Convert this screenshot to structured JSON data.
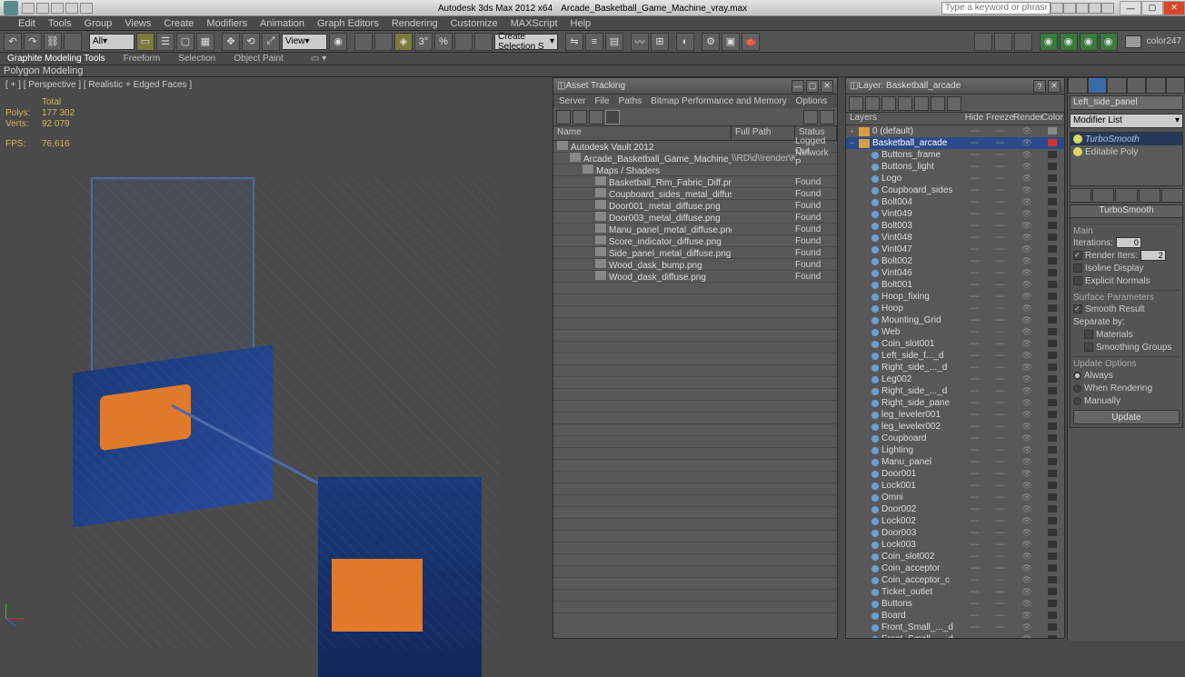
{
  "titlebar": {
    "app": "Autodesk 3ds Max 2012 x64",
    "file": "Arcade_Basketball_Game_Machine_vray.max",
    "search_placeholder": "Type a keyword or phrase"
  },
  "menu": [
    "Edit",
    "Tools",
    "Group",
    "Views",
    "Create",
    "Modifiers",
    "Animation",
    "Graph Editors",
    "Rendering",
    "Customize",
    "MAXScript",
    "Help"
  ],
  "toolbar": {
    "sel_filter": "All",
    "named_sel": "Create Selection S",
    "ref_coord": "View",
    "swatch_label": "color247"
  },
  "ribbon": [
    "Graphite Modeling Tools",
    "Freeform",
    "Selection",
    "Object Paint"
  ],
  "poly_label": "Polygon Modeling",
  "viewport": {
    "label": "[ + ] [ Perspective ] [ Realistic + Edged Faces ]",
    "stats": {
      "total": "Total",
      "polys_l": "Polys:",
      "polys": "177 302",
      "verts_l": "Verts:",
      "verts": "92 079",
      "fps_l": "FPS:",
      "fps": "76,616"
    }
  },
  "asset": {
    "title": "Asset Tracking",
    "menu": [
      "Server",
      "File",
      "Paths",
      "Bitmap Performance and Memory",
      "Options"
    ],
    "cols": {
      "name": "Name",
      "path": "Full Path",
      "status": "Status"
    },
    "rows": [
      {
        "indent": 0,
        "icon": "vault",
        "name": "Autodesk Vault 2012",
        "path": "",
        "status": "Logged Out"
      },
      {
        "indent": 1,
        "icon": "max",
        "name": "Arcade_Basketball_Game_Machine_vray....",
        "path": "\\\\RD\\d\\!render\\K...",
        "status": "Network P"
      },
      {
        "indent": 2,
        "icon": "folder",
        "name": "Maps / Shaders",
        "path": "",
        "status": ""
      },
      {
        "indent": 3,
        "icon": "img",
        "name": "Basketball_Rim_Fabric_Diff.png",
        "path": "",
        "status": "Found"
      },
      {
        "indent": 3,
        "icon": "img",
        "name": "Coupboard_sides_metal_diffuse.png",
        "path": "",
        "status": "Found"
      },
      {
        "indent": 3,
        "icon": "img",
        "name": "Door001_metal_diffuse.png",
        "path": "",
        "status": "Found"
      },
      {
        "indent": 3,
        "icon": "img",
        "name": "Door003_metal_diffuse.png",
        "path": "",
        "status": "Found"
      },
      {
        "indent": 3,
        "icon": "img",
        "name": "Manu_panel_metal_diffuse.png",
        "path": "",
        "status": "Found"
      },
      {
        "indent": 3,
        "icon": "img",
        "name": "Score_indicator_diffuse.png",
        "path": "",
        "status": "Found"
      },
      {
        "indent": 3,
        "icon": "img",
        "name": "Side_panel_metal_diffuse.png",
        "path": "",
        "status": "Found"
      },
      {
        "indent": 3,
        "icon": "img",
        "name": "Wood_dask_bump.png",
        "path": "",
        "status": "Found"
      },
      {
        "indent": 3,
        "icon": "img",
        "name": "Wood_dask_diffuse.png",
        "path": "",
        "status": "Found"
      }
    ]
  },
  "layers": {
    "title": "Layer: Basketball_arcade",
    "cols": {
      "name": "Layers",
      "hide": "Hide",
      "freeze": "Freeze",
      "render": "Render",
      "color": "Color"
    },
    "rows": [
      {
        "depth": 0,
        "type": "layer",
        "name": "0 (default)",
        "sel": false,
        "sw": "#888"
      },
      {
        "depth": 0,
        "type": "layer",
        "name": "Basketball_arcade",
        "sel": true,
        "sw": "#c33"
      },
      {
        "depth": 1,
        "type": "obj",
        "name": "Buttons_frame"
      },
      {
        "depth": 1,
        "type": "obj",
        "name": "Buttons_light"
      },
      {
        "depth": 1,
        "type": "obj",
        "name": "Logo"
      },
      {
        "depth": 1,
        "type": "obj",
        "name": "Coupboard_sides"
      },
      {
        "depth": 1,
        "type": "obj",
        "name": "Bolt004"
      },
      {
        "depth": 1,
        "type": "obj",
        "name": "Vint049"
      },
      {
        "depth": 1,
        "type": "obj",
        "name": "Bolt003"
      },
      {
        "depth": 1,
        "type": "obj",
        "name": "Vint048"
      },
      {
        "depth": 1,
        "type": "obj",
        "name": "Vint047"
      },
      {
        "depth": 1,
        "type": "obj",
        "name": "Bolt002"
      },
      {
        "depth": 1,
        "type": "obj",
        "name": "Vint046"
      },
      {
        "depth": 1,
        "type": "obj",
        "name": "Bolt001"
      },
      {
        "depth": 1,
        "type": "obj",
        "name": "Hoop_fixing"
      },
      {
        "depth": 1,
        "type": "obj",
        "name": "Hoop"
      },
      {
        "depth": 1,
        "type": "obj",
        "name": "Mounting_Grid"
      },
      {
        "depth": 1,
        "type": "obj",
        "name": "Web"
      },
      {
        "depth": 1,
        "type": "obj",
        "name": "Coin_slot001"
      },
      {
        "depth": 1,
        "type": "obj",
        "name": "Left_side_f..._d"
      },
      {
        "depth": 1,
        "type": "obj",
        "name": "Right_side_..._d"
      },
      {
        "depth": 1,
        "type": "obj",
        "name": "Leg002"
      },
      {
        "depth": 1,
        "type": "obj",
        "name": "Right_side_..._d"
      },
      {
        "depth": 1,
        "type": "obj",
        "name": "Right_side_pane"
      },
      {
        "depth": 1,
        "type": "obj",
        "name": "leg_leveler001"
      },
      {
        "depth": 1,
        "type": "obj",
        "name": "leg_leveler002"
      },
      {
        "depth": 1,
        "type": "obj",
        "name": "Coupboard"
      },
      {
        "depth": 1,
        "type": "obj",
        "name": "Lighting"
      },
      {
        "depth": 1,
        "type": "obj",
        "name": "Manu_panel"
      },
      {
        "depth": 1,
        "type": "obj",
        "name": "Door001"
      },
      {
        "depth": 1,
        "type": "obj",
        "name": "Lock001"
      },
      {
        "depth": 1,
        "type": "obj",
        "name": "Omni"
      },
      {
        "depth": 1,
        "type": "obj",
        "name": "Door002"
      },
      {
        "depth": 1,
        "type": "obj",
        "name": "Lock002"
      },
      {
        "depth": 1,
        "type": "obj",
        "name": "Door003"
      },
      {
        "depth": 1,
        "type": "obj",
        "name": "Lock003"
      },
      {
        "depth": 1,
        "type": "obj",
        "name": "Coin_slot002"
      },
      {
        "depth": 1,
        "type": "obj",
        "name": "Coin_acceptor"
      },
      {
        "depth": 1,
        "type": "obj",
        "name": "Coin_acceptor_c"
      },
      {
        "depth": 1,
        "type": "obj",
        "name": "Ticket_outlet"
      },
      {
        "depth": 1,
        "type": "obj",
        "name": "Buttons"
      },
      {
        "depth": 1,
        "type": "obj",
        "name": "Board"
      },
      {
        "depth": 1,
        "type": "obj",
        "name": "Front_Small_..._d"
      },
      {
        "depth": 1,
        "type": "obj",
        "name": "Front_Small_..._d"
      }
    ]
  },
  "cmd": {
    "obj_name": "Left_side_panel",
    "mod_list": "Modifier List",
    "stack": [
      {
        "name": "TurboSmooth",
        "sel": true
      },
      {
        "name": "Editable Poly",
        "sel": false
      }
    ],
    "rollout_title": "TurboSmooth",
    "main": "Main",
    "iter_l": "Iterations:",
    "iter": "0",
    "rend_l": "Render Iters:",
    "rend": "2",
    "isoline": "Isoline Display",
    "explicit": "Explicit Normals",
    "surf": "Surface Parameters",
    "smooth": "Smooth Result",
    "sep": "Separate by:",
    "mats": "Materials",
    "sg": "Smoothing Groups",
    "upd": "Update Options",
    "always": "Always",
    "when": "When Rendering",
    "manual": "Manually",
    "update_btn": "Update"
  }
}
